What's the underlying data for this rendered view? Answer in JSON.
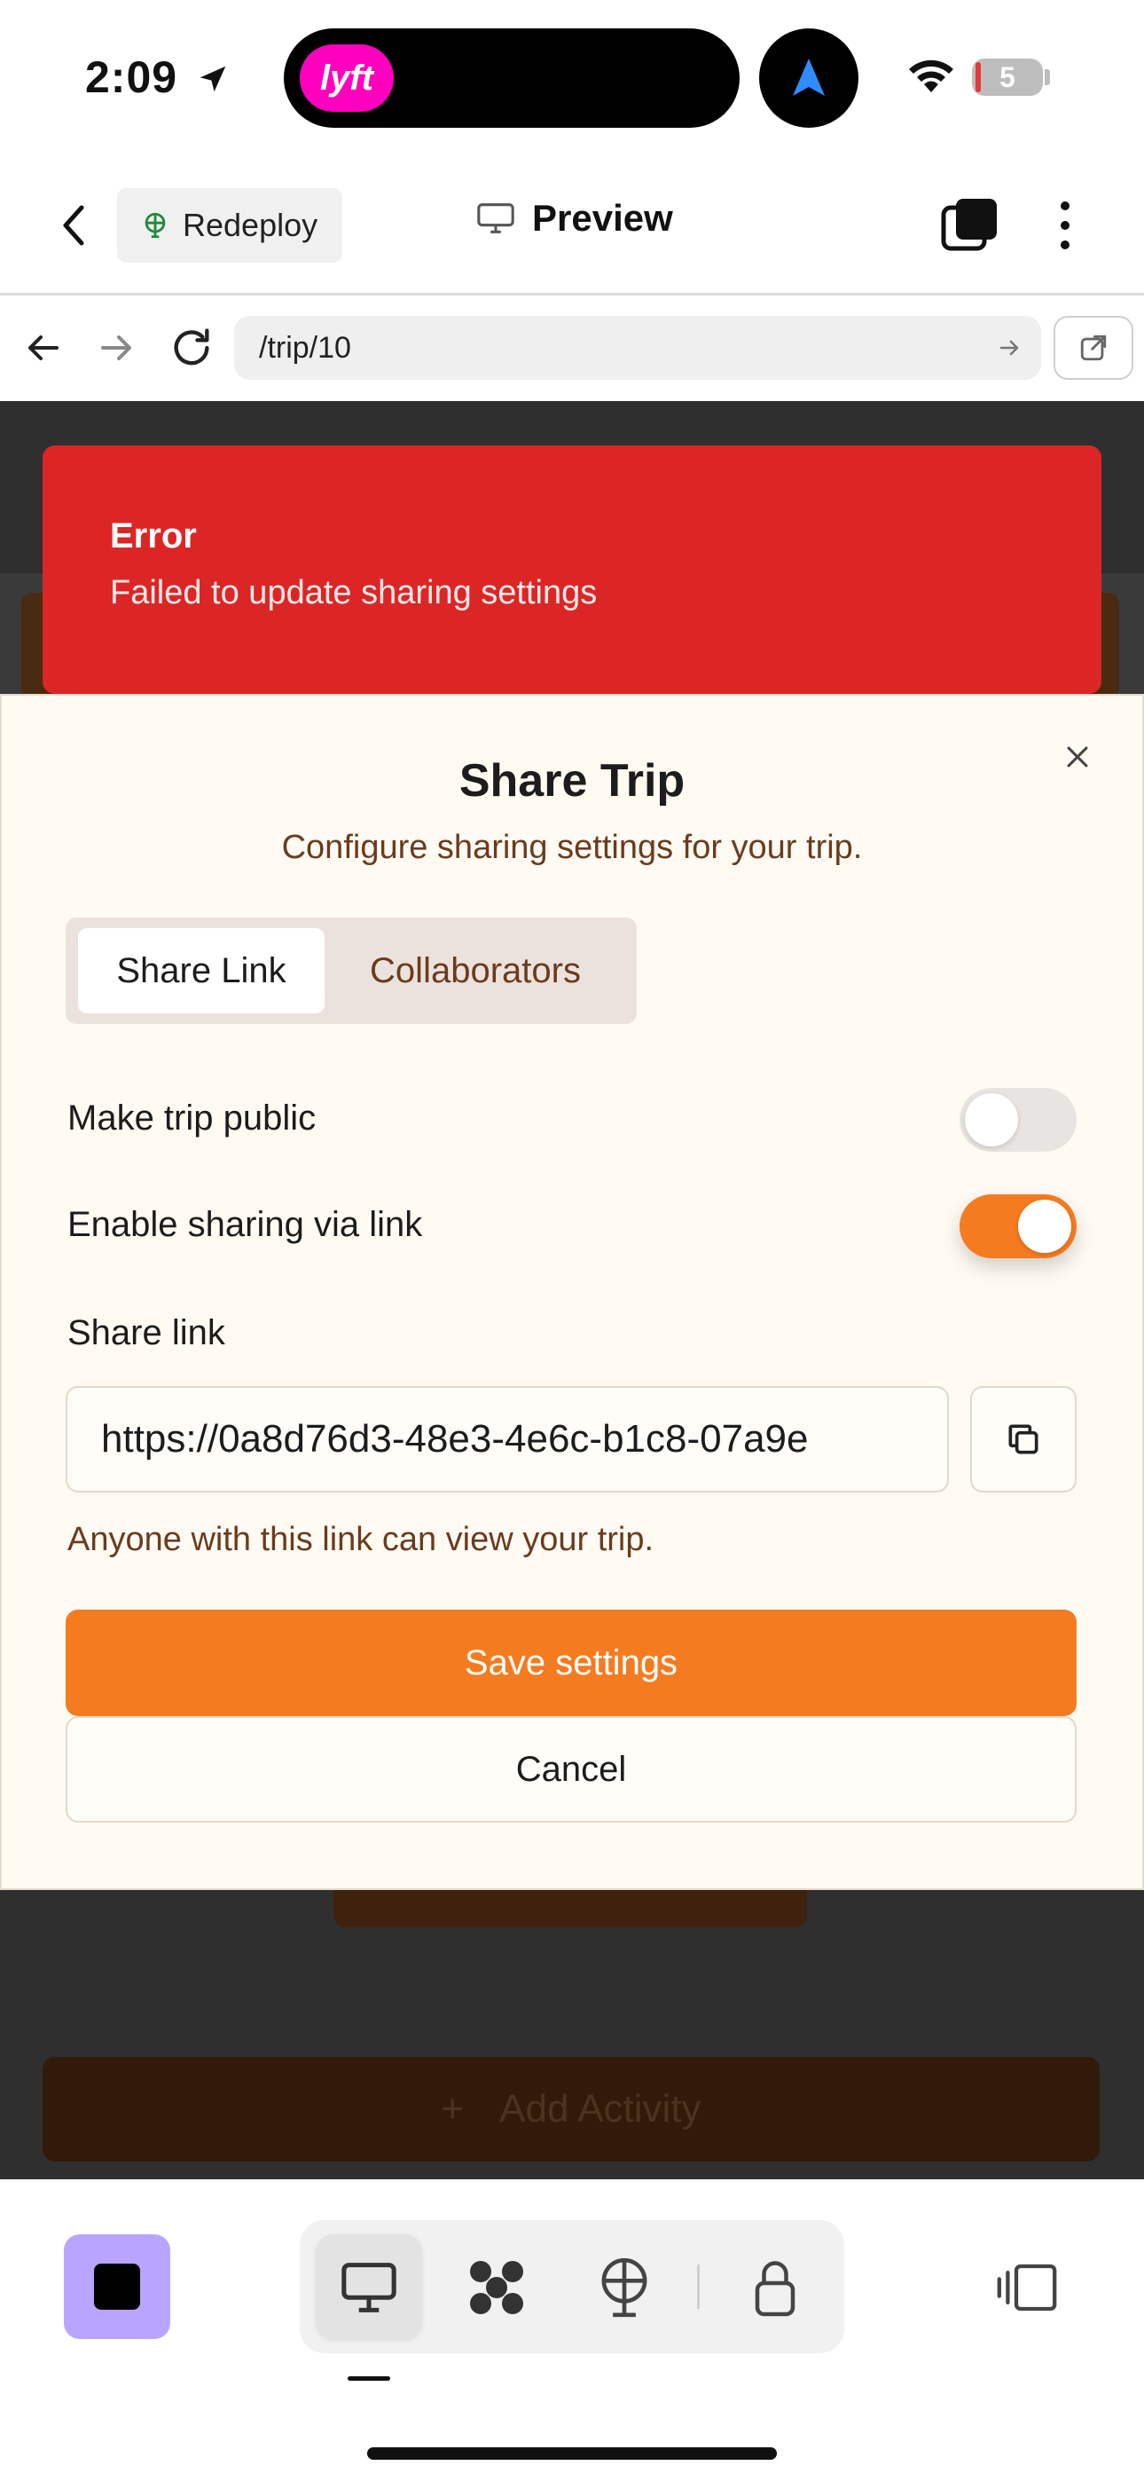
{
  "status_bar": {
    "time": "2:09",
    "live_activity_label": "lyft",
    "battery_level": "5"
  },
  "header": {
    "redeploy_label": "Redeploy",
    "title": "Preview"
  },
  "url_bar": {
    "path": "/trip/10"
  },
  "toast": {
    "title": "Error",
    "message": "Failed to update sharing settings"
  },
  "dialog": {
    "title": "Share Trip",
    "subtitle": "Configure sharing settings for your trip.",
    "tabs": [
      {
        "label": "Share Link",
        "active": true
      },
      {
        "label": "Collaborators",
        "active": false
      }
    ],
    "make_public": {
      "label": "Make trip public",
      "enabled": false
    },
    "enable_link": {
      "label": "Enable sharing via link",
      "enabled": true
    },
    "share_link": {
      "label": "Share link",
      "value": "https://0a8d76d3-48e3-4e6c-b1c8-07a9e",
      "helper": "Anyone with this link can view your trip."
    },
    "save_label": "Save settings",
    "cancel_label": "Cancel"
  },
  "background": {
    "add_activity_plus": "+",
    "add_activity_label": "Add Activity"
  },
  "colors": {
    "accent": "#f47b20",
    "error": "#dc2626",
    "dialog_bg": "#fffbf3",
    "muted_brown": "#6b3b1e",
    "stop_button": "#b9a5ff"
  },
  "icons": {
    "back": "chevron-left-icon",
    "redeploy": "globe-icon",
    "preview": "monitor-icon",
    "tabs": "tabs-icon",
    "more": "more-vertical-icon",
    "nav_back": "arrow-left-icon",
    "nav_forward": "arrow-right-icon",
    "reload": "reload-icon",
    "open_external": "external-link-icon",
    "copy": "copy-icon",
    "close": "close-icon",
    "toolbar": [
      "monitor-icon",
      "pattern-icon",
      "globe-icon",
      "lock-icon",
      "sidebar-icon"
    ]
  }
}
